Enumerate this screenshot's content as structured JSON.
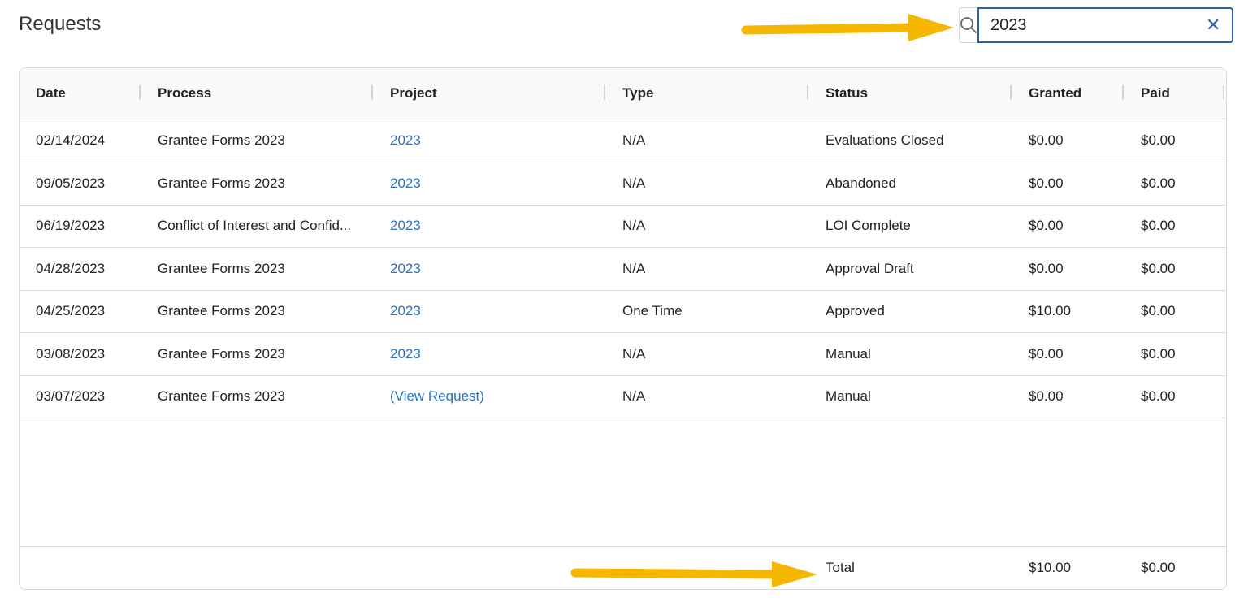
{
  "page": {
    "title": "Requests"
  },
  "search": {
    "value": "2023",
    "icon": "search-icon",
    "clear_icon": "close-icon"
  },
  "table": {
    "columns": [
      "Date",
      "Process",
      "Project",
      "Type",
      "Status",
      "Granted",
      "Paid"
    ],
    "rows": [
      {
        "date": "02/14/2024",
        "process": "Grantee Forms 2023",
        "project": "2023",
        "type": "N/A",
        "status": "Evaluations Closed",
        "granted": "$0.00",
        "paid": "$0.00"
      },
      {
        "date": "09/05/2023",
        "process": "Grantee Forms 2023",
        "project": "2023",
        "type": "N/A",
        "status": "Abandoned",
        "granted": "$0.00",
        "paid": "$0.00"
      },
      {
        "date": "06/19/2023",
        "process": "Conflict of Interest and Confid...",
        "project": "2023",
        "type": "N/A",
        "status": "LOI Complete",
        "granted": "$0.00",
        "paid": "$0.00"
      },
      {
        "date": "04/28/2023",
        "process": "Grantee Forms 2023",
        "project": "2023",
        "type": "N/A",
        "status": "Approval Draft",
        "granted": "$0.00",
        "paid": "$0.00"
      },
      {
        "date": "04/25/2023",
        "process": "Grantee Forms 2023",
        "project": "2023",
        "type": "One Time",
        "status": "Approved",
        "granted": "$10.00",
        "paid": "$0.00"
      },
      {
        "date": "03/08/2023",
        "process": "Grantee Forms 2023",
        "project": "2023",
        "type": "N/A",
        "status": "Manual",
        "granted": "$0.00",
        "paid": "$0.00"
      },
      {
        "date": "03/07/2023",
        "process": "Grantee Forms 2023",
        "project": "(View Request)",
        "type": "N/A",
        "status": "Manual",
        "granted": "$0.00",
        "paid": "$0.00"
      }
    ],
    "footer": {
      "label": "Total",
      "granted": "$10.00",
      "paid": "$0.00"
    }
  },
  "colors": {
    "link": "#2a73c2",
    "accent_border": "#2c5fa6",
    "annotation_arrow": "#f6b700"
  }
}
